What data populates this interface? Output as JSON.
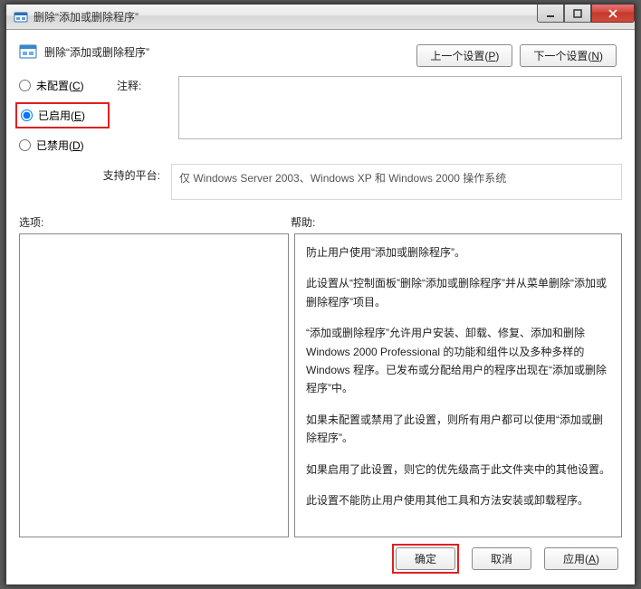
{
  "window": {
    "title": "删除“添加或删除程序”"
  },
  "header": {
    "title": "删除“添加或删除程序”",
    "prev_button": "上一个设置(P)",
    "next_button": "下一个设置(N)"
  },
  "radios": {
    "not_configured": "未配置(C)",
    "enabled": "已启用(E)",
    "disabled": "已禁用(D)",
    "selected": "enabled"
  },
  "labels": {
    "comment": "注释:",
    "platform": "支持的平台:",
    "options": "选项:",
    "help": "帮助:"
  },
  "platform_text": "仅 Windows Server 2003、Windows XP 和 Windows 2000 操作系统",
  "help_paragraphs": [
    "防止用户使用“添加或删除程序”。",
    "此设置从“控制面板”删除“添加或删除程序”并从菜单删除“添加或删除程序”项目。",
    "“添加或删除程序”允许用户安装、卸载、修复、添加和删除 Windows 2000 Professional 的功能和组件以及多种多样的 Windows 程序。已发布或分配给用户的程序出现在“添加或删除程序”中。",
    "如果未配置或禁用了此设置，则所有用户都可以使用“添加或删除程序”。",
    "如果启用了此设置，则它的优先级高于此文件夹中的其他设置。",
    "此设置不能防止用户使用其他工具和方法安装或卸载程序。"
  ],
  "footer": {
    "ok": "确定",
    "cancel": "取消",
    "apply": "应用(A)"
  }
}
